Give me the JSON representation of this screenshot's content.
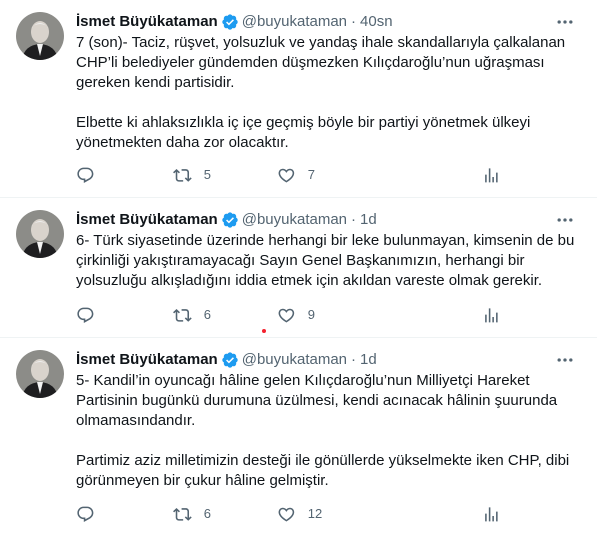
{
  "tweets": [
    {
      "name": "İsmet Büyükataman",
      "handle": "@buyukataman",
      "dot": "·",
      "time": "40sn",
      "paragraphs": [
        "7 (son)- Taciz, rüşvet, yolsuzluk ve yandaş ihale skandallarıyla çalkalanan CHP’li belediyeler gündemden düşmezken Kılıçdaroğlu’nun uğraşması gereken kendi partisidir.",
        "Elbette ki ahlaksızlıkla iç içe geçmiş böyle bir partiyi yönetmek ülkeyi yönetmekten daha zor olacaktır."
      ],
      "retweets": "5",
      "likes": "7"
    },
    {
      "name": "İsmet Büyükataman",
      "handle": "@buyukataman",
      "dot": "·",
      "time": "1d",
      "paragraphs": [
        "6- Türk siyasetinde üzerinde herhangi bir leke bulunmayan, kimsenin de bu çirkinliği yakıştıramayacağı Sayın Genel Başkanımızın, herhangi bir yolsuzluğu alkışladığını iddia etmek için akıldan vareste olmak gerekir."
      ],
      "retweets": "6",
      "likes": "9"
    },
    {
      "name": "İsmet Büyükataman",
      "handle": "@buyukataman",
      "dot": "·",
      "time": "1d",
      "paragraphs": [
        "5- Kandil’in oyuncağı hâline gelen Kılıçdaroğlu’nun Milliyetçi Hareket Partisinin bugünkü durumuna üzülmesi, kendi acınacak hâlinin şuurunda olmamasındandır.",
        "Partimiz aziz milletimizin desteği ile gönüllerde yükselmekte iken CHP, dibi görünmeyen bir çukur hâline gelmiştir."
      ],
      "retweets": "6",
      "likes": "12"
    }
  ],
  "icons": {
    "verified": "verified-badge-icon",
    "more": "more-horizontal-icon",
    "reply": "reply-icon",
    "retweet": "retweet-icon",
    "like": "heart-icon",
    "analytics": "analytics-icon"
  },
  "colors": {
    "verified": "#1d9bf0",
    "secondary_text": "#536471",
    "divider": "#eff3f4",
    "notification_dot": "#f4212e"
  }
}
